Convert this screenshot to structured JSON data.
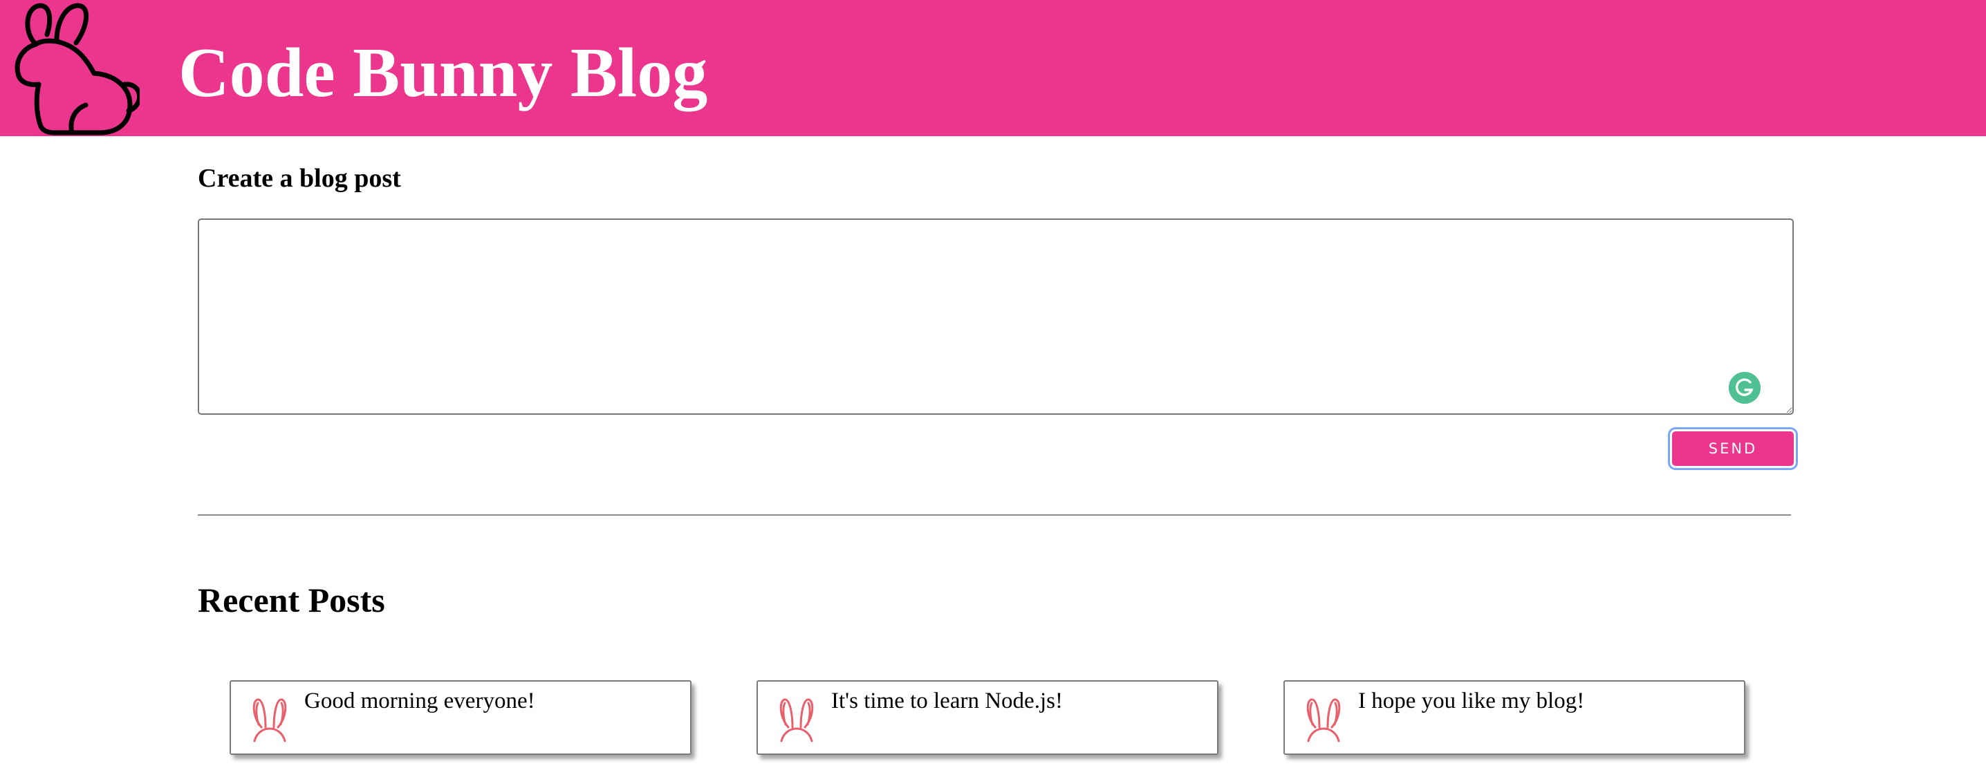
{
  "header": {
    "logo_icon": "bunny-outline-icon",
    "title": "Code Bunny Blog",
    "background_color": "#ec368d"
  },
  "create_post": {
    "heading": "Create a blog post",
    "textarea_value": "",
    "grammarly_icon": "grammarly-icon",
    "send_label": "SEND"
  },
  "recent": {
    "heading": "Recent Posts",
    "posts": [
      {
        "text": "Good morning everyone!",
        "icon": "bunny-ears-icon"
      },
      {
        "text": "It's time to learn Node.js!",
        "icon": "bunny-ears-icon"
      },
      {
        "text": "I hope you like my blog!",
        "icon": "bunny-ears-icon"
      }
    ]
  }
}
